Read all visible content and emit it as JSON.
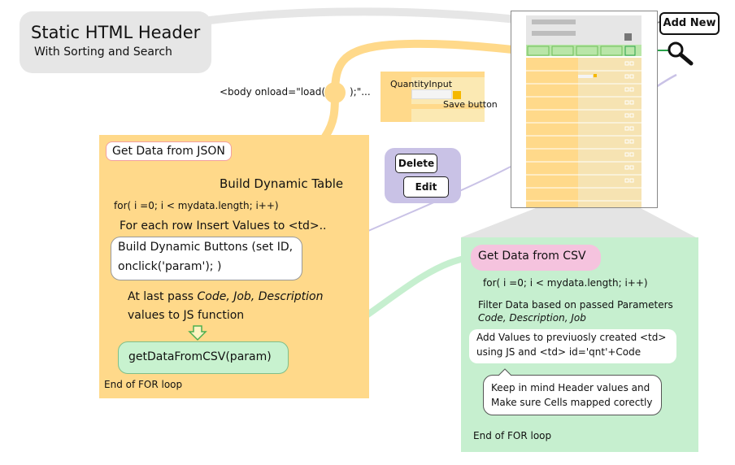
{
  "header": {
    "title": "Static HTML Header",
    "subtitle": "With Sorting and Search"
  },
  "onload": {
    "prefix": "<body onload=\"load(",
    "suffix": ");\"..."
  },
  "quantity_panel": {
    "input_label": "QuantityInput",
    "save_label": "Save button"
  },
  "json_section": {
    "title": "Get Data from JSON",
    "build_table": "Build Dynamic Table",
    "for_loop": "for( i =0; i < mydata.length; i++)",
    "each_row": "For each row Insert Values to <td>..",
    "buttons_line1": "Build Dynamic Buttons (set ID,",
    "buttons_line2": "onclick('param'); )",
    "last_pass_prefix": "At last pass ",
    "last_pass_italic": "Code, Job, Description",
    "last_pass_line2": "values to JS function",
    "function_call": "getDataFromCSV(param)",
    "end_loop": "End of FOR loop"
  },
  "row_buttons": {
    "delete_label": "Delete",
    "edit_label": "Edit"
  },
  "table_preview": {
    "add_new_label": "Add New",
    "search_icon": "search-icon"
  },
  "csv_section": {
    "title": "Get Data from CSV",
    "for_loop": "for( i =0; i < mydata.length; i++)",
    "filter_line1": "Filter Data based on passed Parameters",
    "filter_line2": "Code, Description, Job",
    "add_values_line1": "Add Values to previuosly created <td>",
    "add_values_line2": "using JS and <td> id='qnt'+Code",
    "note_line1": "Keep in mind Header values and",
    "note_line2": "Make sure Cells mapped corectly",
    "end_loop": "End of FOR loop"
  },
  "colors": {
    "json_panel": "#ffd98a",
    "csv_panel": "#c6efcf",
    "connector_yellow": "#ffd98a",
    "connector_green": "#c6efcf",
    "connector_purple": "#c9c2e6",
    "header_box": "#e6e6e6"
  }
}
